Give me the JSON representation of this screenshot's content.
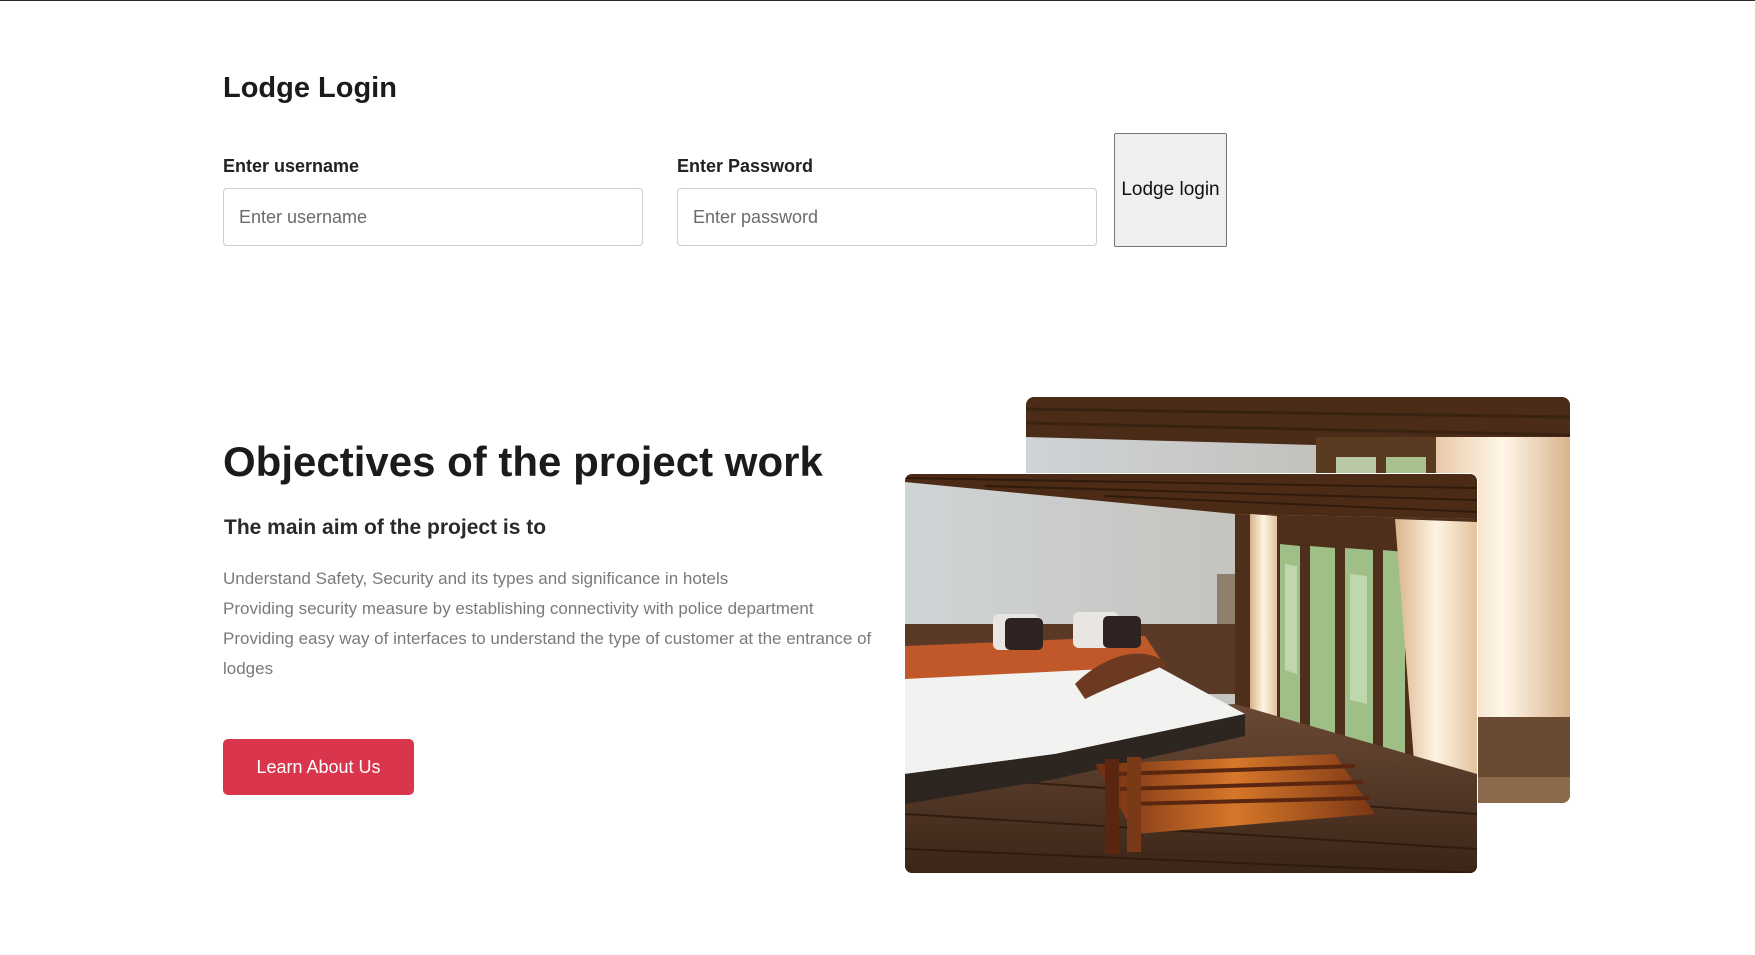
{
  "login": {
    "title": "Lodge Login",
    "username_label": "Enter username",
    "username_placeholder": "Enter username",
    "username_value": "",
    "password_label": "Enter Password",
    "password_placeholder": "Enter password",
    "password_value": "",
    "submit_label": "Lodge login"
  },
  "objectives": {
    "title": "Objectives of the project work",
    "subtitle": "The main aim of the project is to",
    "items": [
      "Understand Safety, Security and its types and significance in hotels",
      "Providing security measure by establishing connectivity with police department",
      "Providing easy way of interfaces to understand the type of customer at the entrance of lodges"
    ],
    "cta_label": "Learn About Us"
  },
  "colors": {
    "accent": "#d9354d",
    "button_gray": "#efefef"
  },
  "icons": {
    "photo_back": "hotel-room-photo",
    "photo_front": "hotel-room-photo"
  }
}
